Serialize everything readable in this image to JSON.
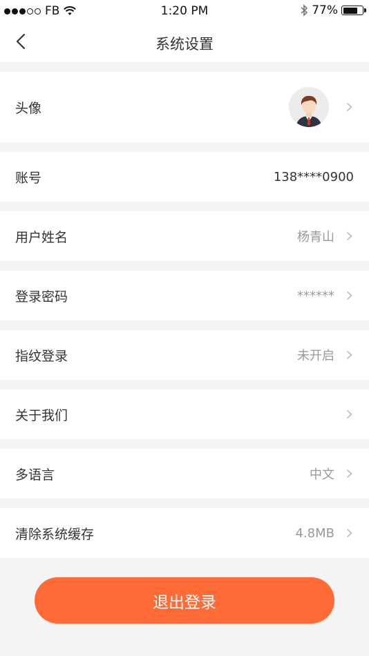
{
  "status_bar": {
    "carrier": "FB",
    "time": "1:20 PM",
    "battery": "77%",
    "battery_level": 0.77
  },
  "nav": {
    "title": "系统设置"
  },
  "rows": {
    "avatar": {
      "label": "头像"
    },
    "account": {
      "label": "账号",
      "value": "138****0900"
    },
    "username": {
      "label": "用户姓名",
      "value": "杨青山"
    },
    "password": {
      "label": "登录密码",
      "value": "******"
    },
    "fingerprint": {
      "label": "指纹登录",
      "value": "未开启"
    },
    "about": {
      "label": "关于我们"
    },
    "language": {
      "label": "多语言",
      "value": "中文"
    },
    "cache": {
      "label": "清除系统缓存",
      "value": "4.8MB"
    }
  },
  "logout": {
    "label": "退出登录"
  },
  "colors": {
    "accent": "#ff6a35",
    "background": "#f4f4f4",
    "secondary_text": "#999999"
  }
}
